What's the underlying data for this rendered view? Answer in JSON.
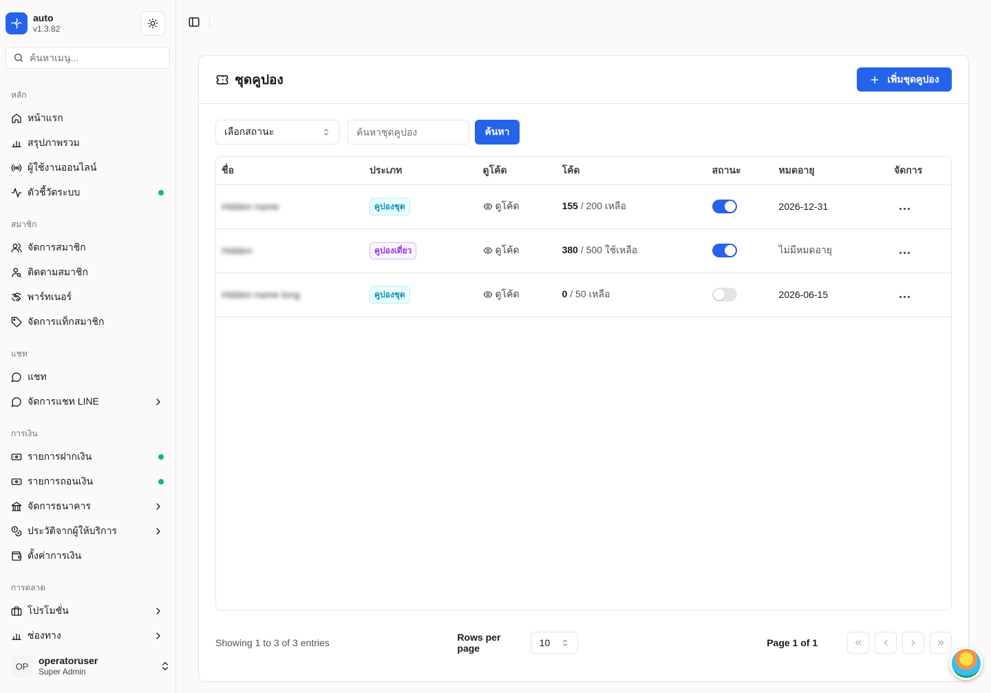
{
  "brand": {
    "name": "auto",
    "version": "v1.3.82"
  },
  "sidebar": {
    "search_placeholder": "ค้นหาเมนู...",
    "groups": [
      {
        "label": "หลัก",
        "items": [
          {
            "label": "หน้าแรก",
            "icon": "home-icon"
          },
          {
            "label": "สรุปภาพรวม",
            "icon": "bar-chart-icon"
          },
          {
            "label": "ผู้ใช้งานออนไลน์",
            "icon": "radio-icon"
          },
          {
            "label": "ตัวชี้วัดระบบ",
            "icon": "activity-icon",
            "status_dot": true
          }
        ]
      },
      {
        "label": "สมาชิก",
        "items": [
          {
            "label": "จัดการสมาชิก",
            "icon": "users-icon"
          },
          {
            "label": "ติดตามสมาชิก",
            "icon": "user-search-icon"
          },
          {
            "label": "พาร์ทเนอร์",
            "icon": "handshake-icon"
          },
          {
            "label": "จัดการแท็กสมาชิก",
            "icon": "tag-icon"
          }
        ]
      },
      {
        "label": "แชท",
        "items": [
          {
            "label": "แชท",
            "icon": "message-circle-icon"
          },
          {
            "label": "จัดการแชท LINE",
            "icon": "message-circle-icon",
            "has_children": true
          }
        ]
      },
      {
        "label": "การเงิน",
        "items": [
          {
            "label": "รายการฝากเงิน",
            "icon": "deposit-icon",
            "status_dot": true
          },
          {
            "label": "รายการถอนเงิน",
            "icon": "withdraw-icon",
            "status_dot": true
          },
          {
            "label": "จัดการธนาคาร",
            "icon": "bank-icon",
            "has_children": true
          },
          {
            "label": "ประวัติจากผู้ให้บริการ",
            "icon": "coins-icon",
            "has_children": true
          },
          {
            "label": "ตั้งค่าการเงิน",
            "icon": "wallet-icon"
          }
        ]
      },
      {
        "label": "การตลาด",
        "items": [
          {
            "label": "โปรโมชั่น",
            "icon": "briefcase-icon",
            "has_children": true
          },
          {
            "label": "ช่องทาง",
            "icon": "bar-chart-icon",
            "has_children": true
          }
        ]
      }
    ]
  },
  "user": {
    "initials": "OP",
    "name": "operatoruser",
    "role": "Super Admin"
  },
  "page": {
    "title": "ชุดคูปอง",
    "add_button": "เพิ่มชุดคูปอง",
    "filters": {
      "status_select": "เลือกสถานะ",
      "search_placeholder": "ค้นหาชุดคูปอง",
      "search_button": "ค้นหา"
    },
    "table": {
      "columns": [
        "ชื่อ",
        "ประเภท",
        "ดูโค้ด",
        "โค้ด",
        "สถานะ",
        "หมดอายุ",
        "จัดการ"
      ],
      "rows": [
        {
          "name": "Hidden name",
          "type": "คูปองชุด",
          "type_color": "cyan",
          "view": "ดูโค้ด",
          "count": "155",
          "count_rest": "/ 200 เหลือ",
          "active": true,
          "expiry": "2026-12-31",
          "expiry_muted": false
        },
        {
          "name": "Hidden",
          "type": "คูปองเดี่ยว",
          "type_color": "purple",
          "view": "ดูโค้ด",
          "count": "380",
          "count_rest": "/ 500 ใช้เหลือ",
          "active": true,
          "expiry": "ไม่มีหมดอายุ",
          "expiry_muted": true
        },
        {
          "name": "Hidden name long",
          "type": "คูปองชุด",
          "type_color": "cyan",
          "view": "ดูโค้ด",
          "count": "0",
          "count_rest": "/ 50 เหลือ",
          "active": false,
          "expiry": "2026-06-15",
          "expiry_muted": false
        }
      ]
    },
    "footer": {
      "showing": "Showing 1 to 3 of 3 entries",
      "rows_per_page_label": "Rows per page",
      "rows_per_page": "10",
      "page_info": "Page 1 of 1"
    }
  },
  "colors": {
    "accent": "#2563eb",
    "status_dot": "#10b981"
  }
}
